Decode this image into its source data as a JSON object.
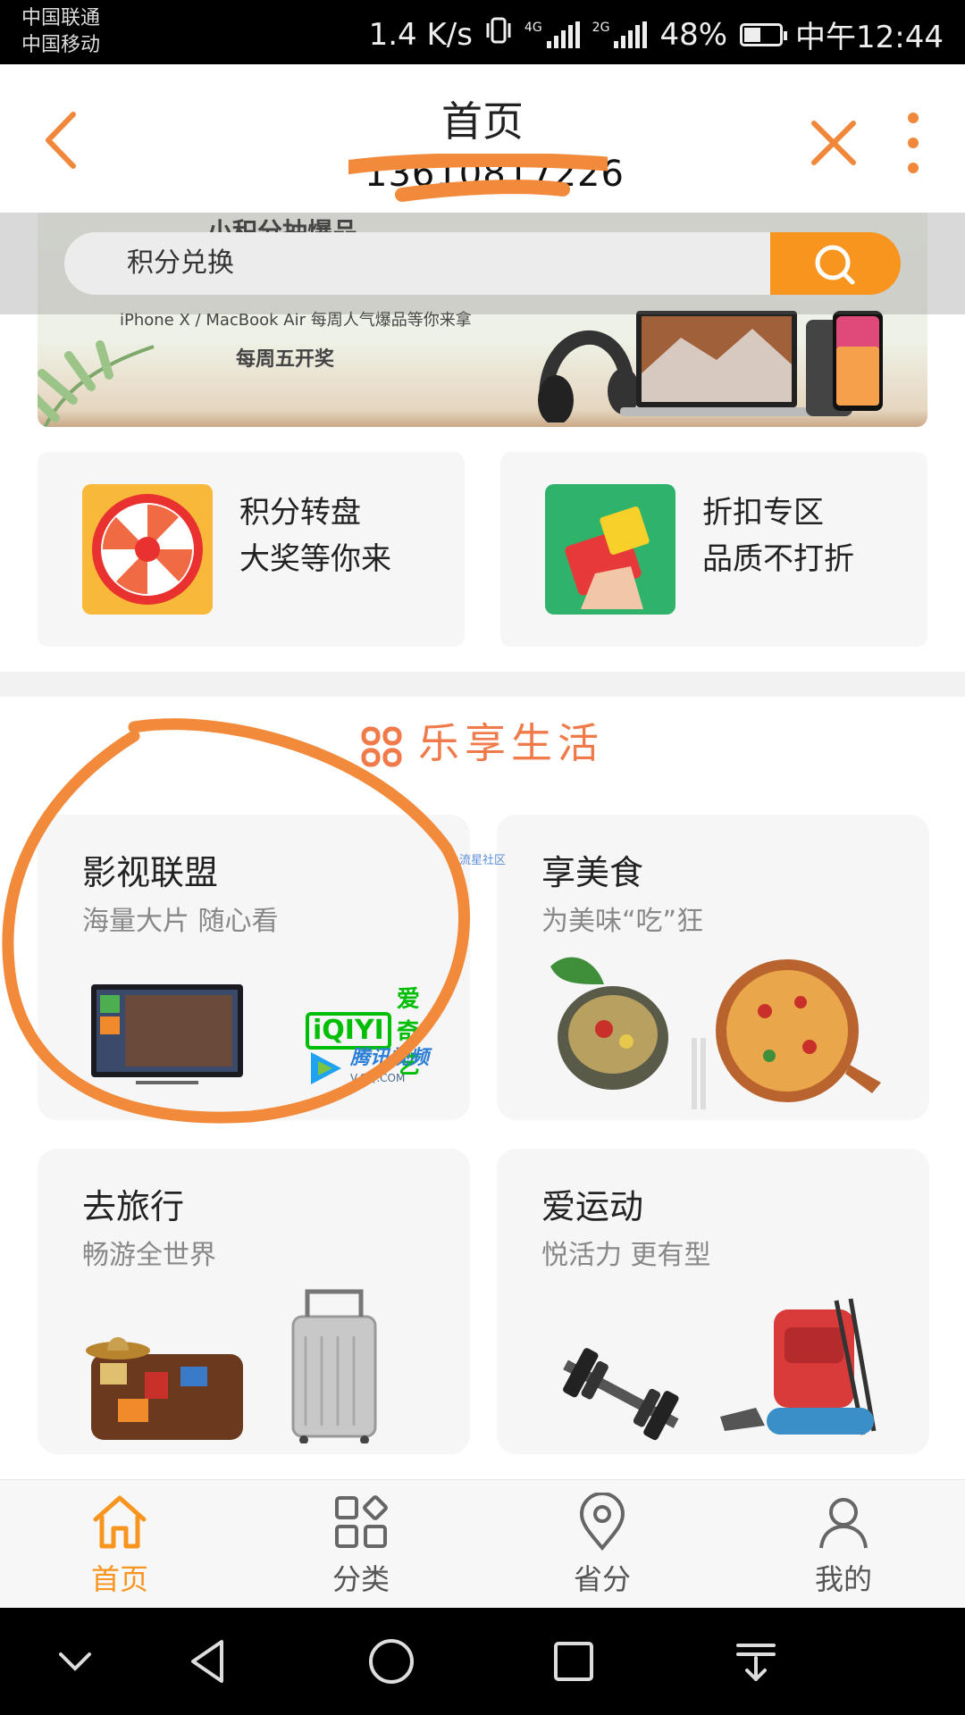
{
  "status_bar": {
    "carrier_1": "中国联通",
    "carrier_2": "中国移动",
    "net_speed": "1.4 K/s",
    "net_4g": "4G",
    "net_2g": "2G",
    "battery": "48%",
    "battery_level": 0.48,
    "time": "中午12:44"
  },
  "header": {
    "title": "首页",
    "subtitle_redacted": "13610817226"
  },
  "banner": {
    "top_text": "小积分抽爆品",
    "line2": "iPhone X / MacBook Air 每周人气爆品等你来拿",
    "line3": "每周五开奖"
  },
  "search": {
    "value": "积分兑换"
  },
  "promos": [
    {
      "line1": "积分转盘",
      "line2": "大奖等你来",
      "icon": "prize-wheel-icon"
    },
    {
      "line1": "折扣专区",
      "line2": "品质不打折",
      "icon": "red-envelope-icon"
    }
  ],
  "section": {
    "title": "乐享生活"
  },
  "life_cards": [
    {
      "title": "影视联盟",
      "subtitle": "海量大片 随心看",
      "brand1": "爱奇艺",
      "brand1_logo": "iQIYI",
      "brand2": "腾讯视频",
      "brand2_url": "V.QQ.COM"
    },
    {
      "title": "享美食",
      "subtitle": "为美味“吃”狂"
    },
    {
      "title": "去旅行",
      "subtitle": "畅游全世界"
    },
    {
      "title": "爱运动",
      "subtitle": "悦活力 更有型"
    }
  ],
  "watermark": "流星社区",
  "tabs": [
    {
      "label": "首页",
      "icon": "home-icon",
      "active": true
    },
    {
      "label": "分类",
      "icon": "category-icon",
      "active": false
    },
    {
      "label": "省分",
      "icon": "location-pin-icon",
      "active": false
    },
    {
      "label": "我的",
      "icon": "user-icon",
      "active": false
    }
  ],
  "colors": {
    "accent": "#f7951f",
    "section_title": "#f07a4a",
    "annotation": "#f28a3c"
  }
}
